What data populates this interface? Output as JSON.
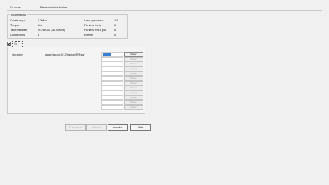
{
  "status": {
    "label": "En cours",
    "value": "Réception des fichiers"
  },
  "info": {
    "title": "Informations",
    "rows_left": [
      {
        "label": "Octets reçus",
        "value": "1.00Mo"
      },
      {
        "label": "Temps",
        "value": "16s"
      },
      {
        "label": "Taux transfert",
        "value": "26.28Ko/s (26.28Ko/s)"
      },
      {
        "label": "Connexions",
        "value": "1"
      }
    ],
    "rows_right": [
      {
        "label": "Liens parcourus",
        "value": "1/1"
      },
      {
        "label": "Fichiers écrits",
        "value": "0"
      },
      {
        "label": "Fichiers mis à jour",
        "value": "0"
      },
      {
        "label": "Erreurs",
        "value": "0"
      }
    ]
  },
  "encours": {
    "label": "En cours:"
  },
  "transfer": {
    "label": "réception",
    "url": "www.hadopi.fr/12/hadopi/FR.swf",
    "active_button": "Passer",
    "inactive_button": "Passer"
  },
  "buttons": {
    "prev": "Précédent",
    "next": "Suivant",
    "cancel": "Annuler",
    "help": "Aide"
  }
}
